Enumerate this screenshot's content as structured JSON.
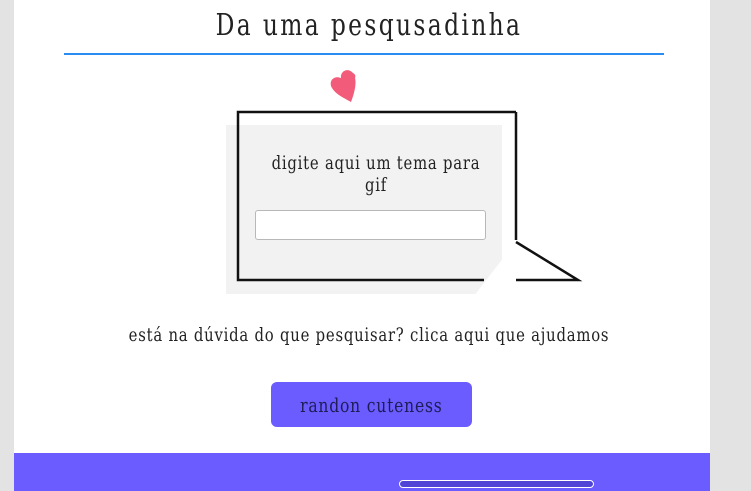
{
  "header": {
    "title": "Da uma pesqusadinha"
  },
  "search": {
    "prompt": "digite aqui um tema para gif",
    "value": "",
    "placeholder": ""
  },
  "help": {
    "text": "está na dúvida do que pesquisar? clica aqui que ajudamos"
  },
  "actions": {
    "random_label": "randon cuteness"
  },
  "icons": {
    "heart": "heart-icon"
  },
  "colors": {
    "accent": "#6a5cff",
    "underline": "#2a8cf0",
    "heart": "#f25c7a",
    "background": "#e3e3e3"
  }
}
